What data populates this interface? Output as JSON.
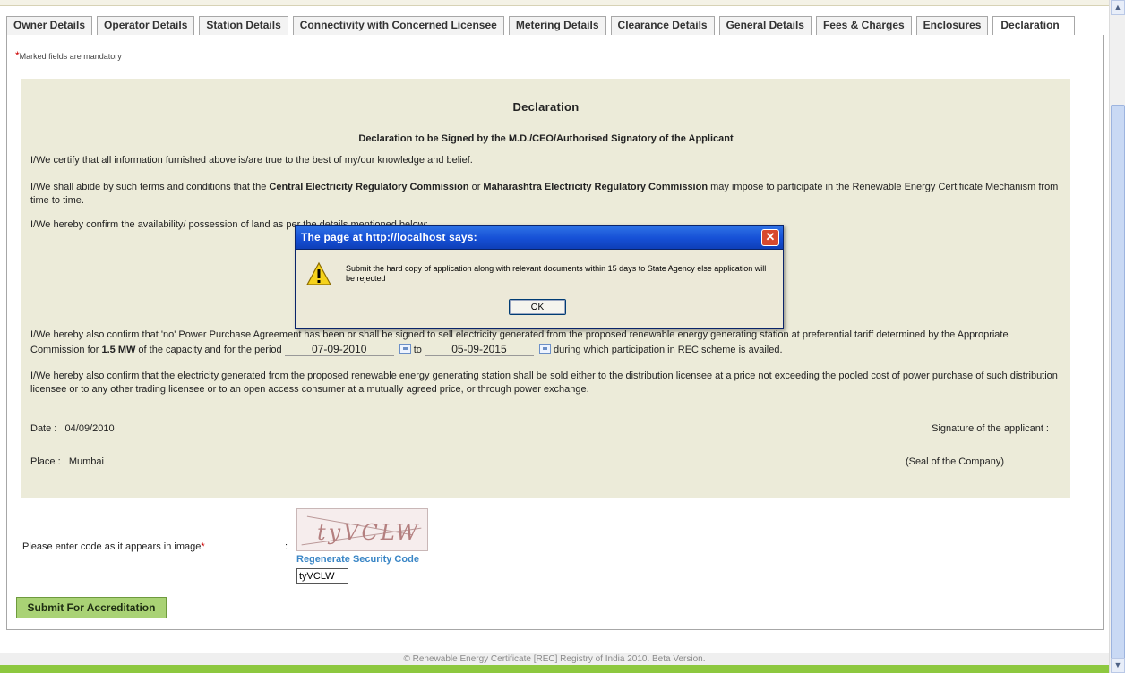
{
  "tabs": [
    {
      "label": "Owner Details"
    },
    {
      "label": "Operator Details"
    },
    {
      "label": "Station Details"
    },
    {
      "label": "Connectivity with Concerned Licensee"
    },
    {
      "label": "Metering Details"
    },
    {
      "label": "Clearance Details"
    },
    {
      "label": "General Details"
    },
    {
      "label": "Fees & Charges"
    },
    {
      "label": "Enclosures"
    },
    {
      "label": "Declaration"
    }
  ],
  "mandatory_note": {
    "star": "*",
    "text": "Marked fields are mandatory"
  },
  "declaration": {
    "title": "Declaration",
    "subtitle": "Declaration to be Signed by the M.D./CEO/Authorised Signatory of the Applicant",
    "p1": "I/We certify that all information furnished above is/are true to the best of my/our knowledge and belief.",
    "p2": {
      "a": "I/We shall abide by such terms and conditions that the ",
      "b": "Central Electricity Regulatory Commission",
      "c": " or ",
      "d": "Maharashtra Electricity Regulatory Commission",
      "e": " may impose to participate in the Renewable Energy Certificate Mechanism from time to time."
    },
    "p3": "I/We hereby confirm the availability/ possession of land as per the details mentioned below:",
    "p4": {
      "a": "I/We hereby also confirm that 'no' Power Purchase Agreement has been or shall be signed to sell electricity generated from the proposed renewable energy generating station at preferential tariff determined by the Appropriate Commission for ",
      "b": "1.5 MW",
      "c": " of the capacity and for the period ",
      "from": "07-09-2010",
      "to_word": "to",
      "to": "05-09-2015",
      "d": "during which participation in REC scheme is availed."
    },
    "p5": "I/We hereby also confirm that the electricity generated from the proposed renewable energy generating station shall be sold either to the distribution licensee at a price not exceeding the pooled cost of power purchase of such distribution licensee or to any other trading licensee or to an open access consumer at a mutually agreed price, or through power exchange.",
    "date_label": "Date :",
    "date_value": "04/09/2010",
    "place_label": "Place :",
    "place_value": "Mumbai",
    "signature_label": "Signature of the applicant :",
    "seal_label": "(Seal of the Company)"
  },
  "captcha": {
    "label": "Please enter code as it appears in image",
    "star": "*",
    "colon": ":",
    "image_text": "tyVCLW",
    "regen_label": "Regenerate Security Code",
    "input_value": "tyVCLW"
  },
  "submit_label": "Submit For Accreditation",
  "footer_text": "© Renewable Energy Certificate [REC] Registry of India 2010. Beta Version.",
  "dialog": {
    "title": "The page at http://localhost says:",
    "close_glyph": "✕",
    "message": "Submit the hard copy of application along with relevant documents within 15 days to State Agency else application will be rejected",
    "ok_label": "OK",
    "icon": "warning-icon"
  },
  "scrollbar": {
    "up_glyph": "▲",
    "down_glyph": "▼"
  },
  "colors": {
    "panel_bg": "#ecebd9",
    "submit_bg": "#a9d275",
    "footer_bar": "#8dc83f",
    "link": "#3a86c6",
    "dialog_title": "#1650d6"
  }
}
